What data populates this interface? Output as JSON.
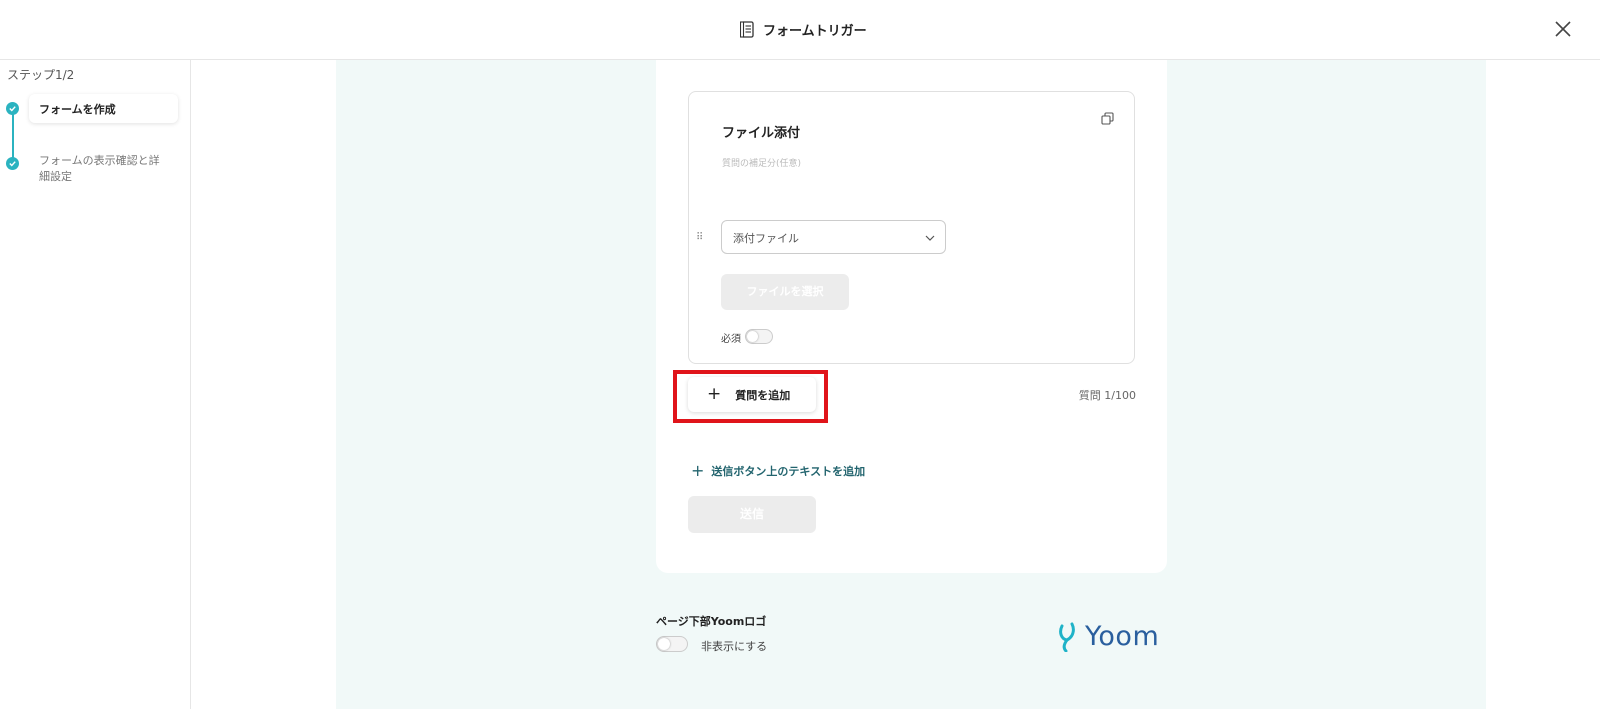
{
  "header": {
    "title": "フォームトリガー"
  },
  "sidebar": {
    "step_count": "ステップ1/2",
    "steps": [
      {
        "label": "フォームを作成"
      },
      {
        "label": "フォームの表示確認と詳細設定"
      }
    ]
  },
  "question": {
    "title": "ファイル添付",
    "description_placeholder": "質問の補足分(任意)",
    "type_select": "添付ファイル",
    "file_button": "ファイルを選択",
    "required_label": "必須"
  },
  "actions": {
    "add_question": "質問を追加",
    "question_count": "質問 1/100",
    "add_text": "送信ボタン上のテキストを追加",
    "submit": "送信"
  },
  "footer": {
    "logo_label": "ページ下部Yoomロゴ",
    "hide_label": "非表示にする",
    "brand": "Yoom"
  },
  "colors": {
    "accent": "#2bb3c0",
    "highlight": "#e0141a",
    "background": "#f1f9f8",
    "brand": "#2a5f9e"
  }
}
